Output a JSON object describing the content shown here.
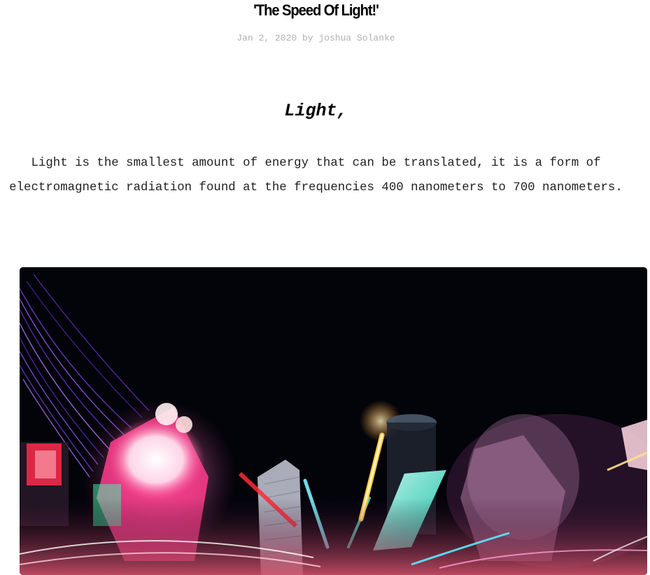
{
  "post": {
    "title": "'The Speed Of Light!'",
    "meta": "Jan 2, 2020 by joshua Solanke",
    "section_heading": "Light,",
    "body": "Light is the smallest amount of energy that can be translated, it is a form of electromagnetic radiation found at the frequencies 400 nanometers to 700 nanometers."
  },
  "image": {
    "subject": "long-exposure-city-lights-photo"
  },
  "colors": {
    "title": "#000000",
    "meta": "#b0b0b0",
    "body": "#222222",
    "image_background": "#03030a"
  }
}
